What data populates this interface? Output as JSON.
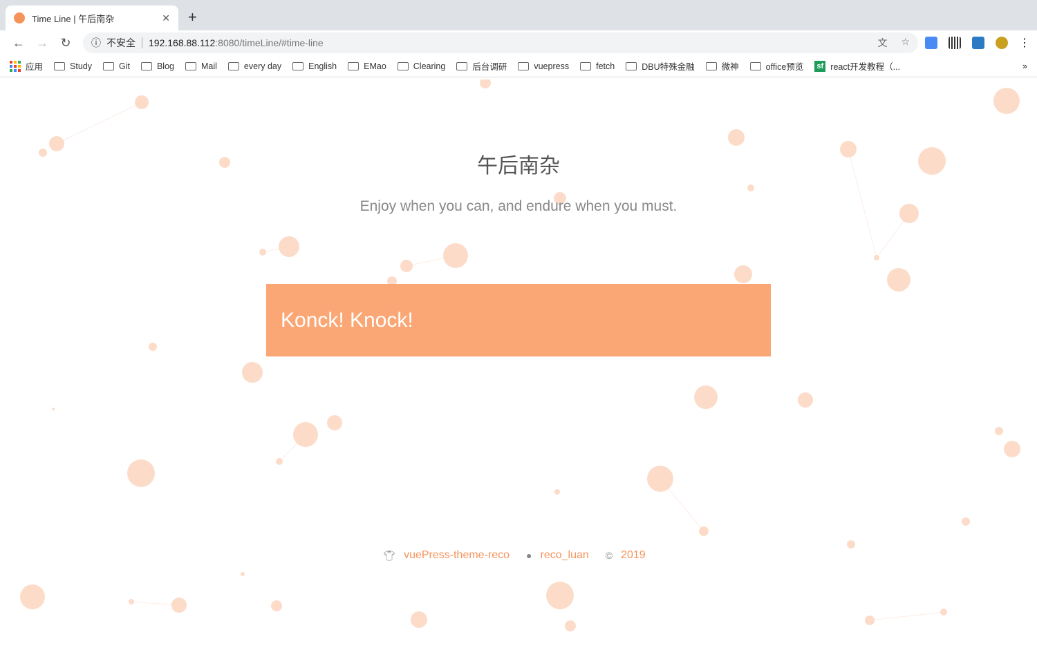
{
  "browser": {
    "tab_title": "Time Line | 午后南杂",
    "security_label": "不安全",
    "url_host": "192.168.88.112",
    "url_path": ":8080/timeLine/#time-line",
    "bookmarks": [
      {
        "label": "应用",
        "icon": "apps-icon"
      },
      {
        "label": "Study"
      },
      {
        "label": "Git"
      },
      {
        "label": "Blog"
      },
      {
        "label": "Mail"
      },
      {
        "label": "every day"
      },
      {
        "label": "English"
      },
      {
        "label": "EMao"
      },
      {
        "label": "Clearing"
      },
      {
        "label": "后台调研"
      },
      {
        "label": "vuepress"
      },
      {
        "label": "fetch"
      },
      {
        "label": "DBU特殊金融"
      },
      {
        "label": "微神"
      },
      {
        "label": "office预览"
      },
      {
        "label": "react开发教程（...",
        "icon": "sf-icon"
      }
    ],
    "more": "»"
  },
  "hero": {
    "title": "午后南杂",
    "description": "Enjoy when you can, and endure when you must."
  },
  "banner": {
    "text": "Konck! Knock!"
  },
  "footer": {
    "theme": "vuePress-theme-reco",
    "author": "reco_luan",
    "year": "2019"
  },
  "colors": {
    "accent": "#f5935a",
    "banner": "#fba775"
  }
}
